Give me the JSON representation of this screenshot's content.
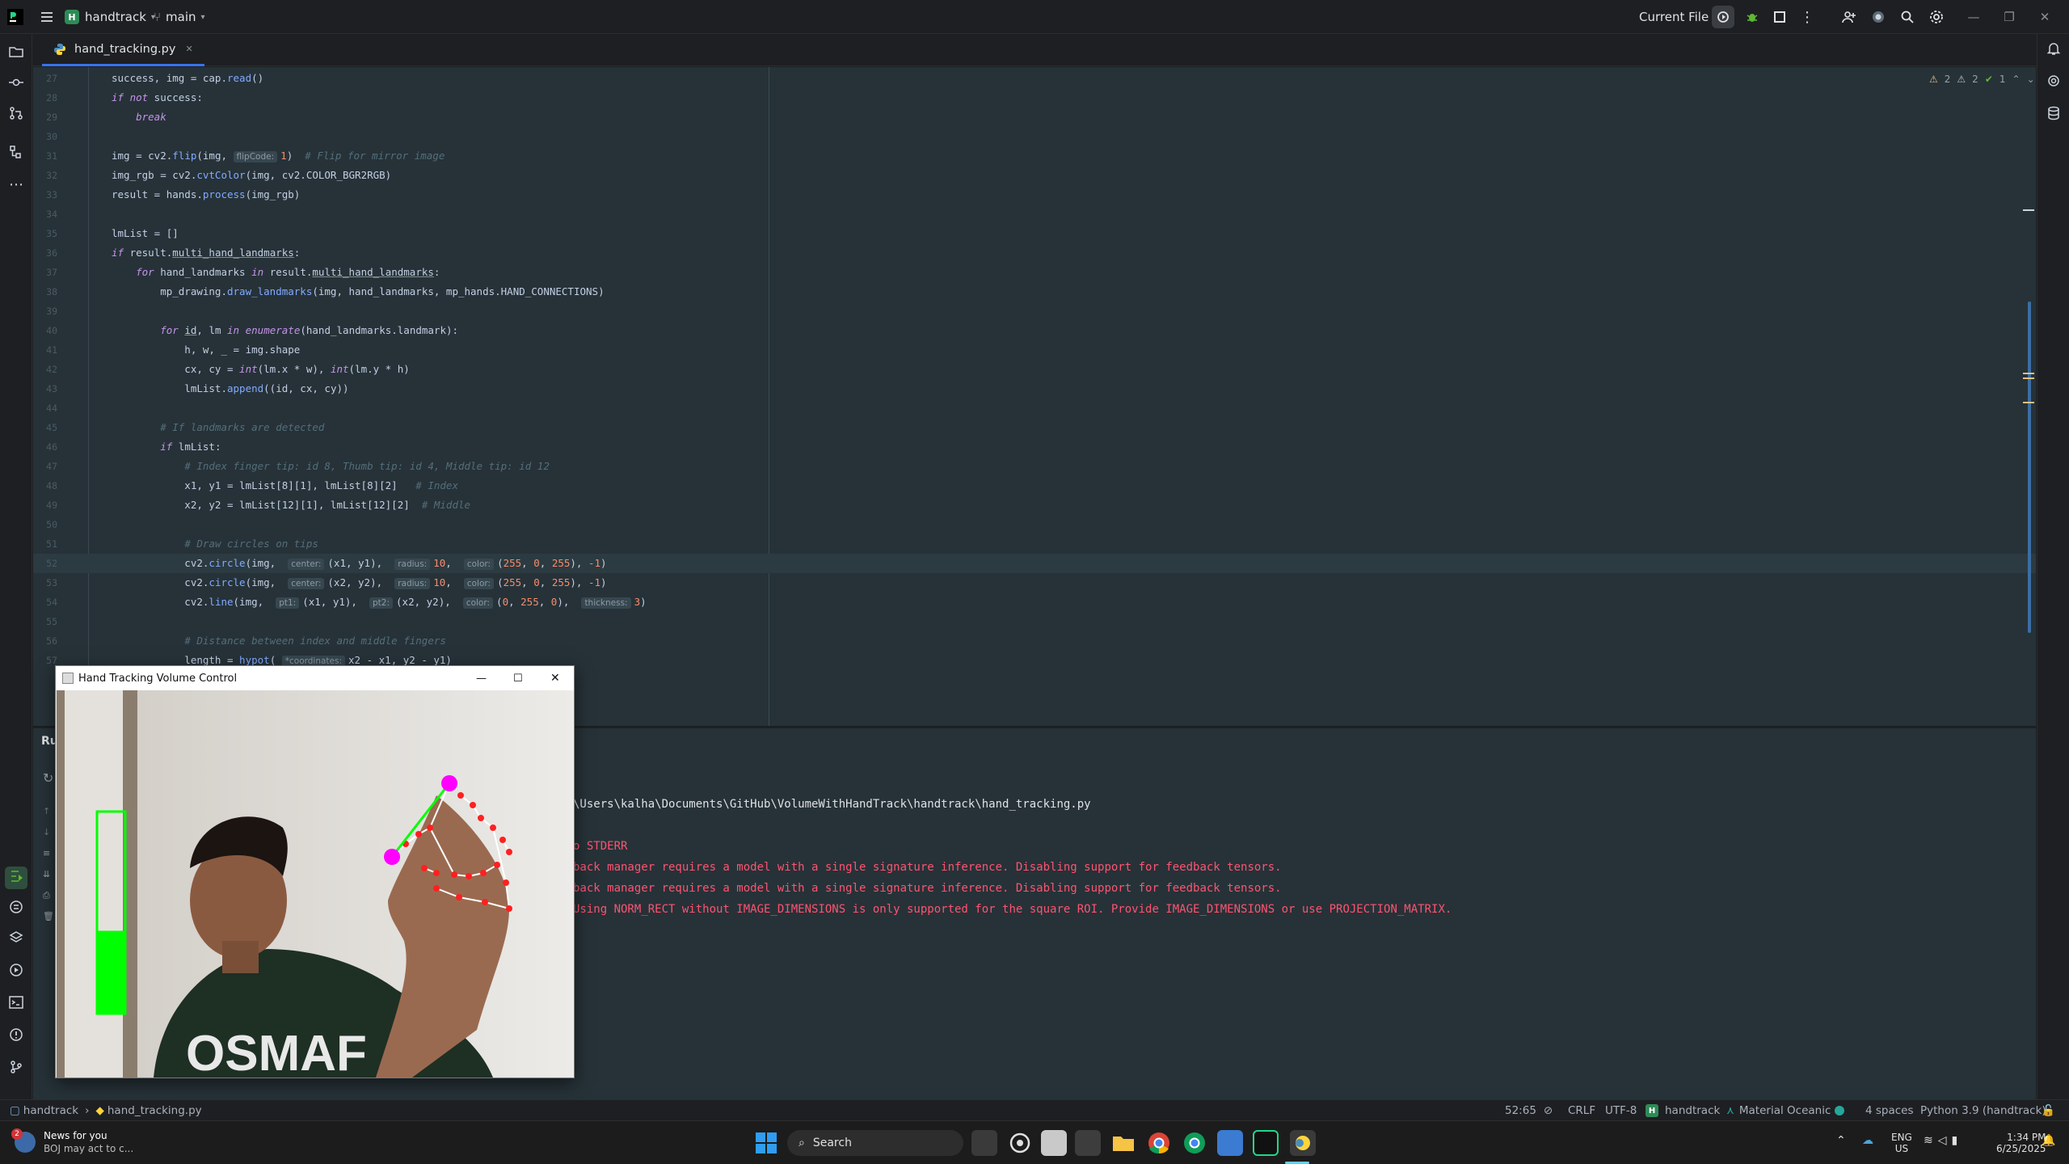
{
  "titlebar": {
    "project_badge": "H",
    "project_name": "handtrack",
    "branch": "main",
    "run_config": "Current File"
  },
  "editor_tab": {
    "filename": "hand_tracking.py"
  },
  "inspections": {
    "warnings_a": "2",
    "warnings_b": "2",
    "ok": "1"
  },
  "code_lines": [
    {
      "n": "27",
      "parts": [
        [
          "p",
          "success, img = cap."
        ],
        [
          "fn",
          "read"
        ],
        [
          "p",
          "()"
        ]
      ]
    },
    {
      "n": "28",
      "parts": [
        [
          "kw",
          "if not"
        ],
        [
          "p",
          " success:"
        ]
      ]
    },
    {
      "n": "29",
      "parts": [
        [
          "p",
          "    "
        ],
        [
          "kw",
          "break"
        ]
      ]
    },
    {
      "n": "30",
      "parts": []
    },
    {
      "n": "31",
      "parts": [
        [
          "p",
          "img = cv2."
        ],
        [
          "fn",
          "flip"
        ],
        [
          "p",
          "(img, "
        ],
        [
          "h",
          "flipCode:"
        ],
        [
          "num",
          "1"
        ],
        [
          "p",
          ")  "
        ],
        [
          "cm",
          "# Flip for mirror image"
        ]
      ]
    },
    {
      "n": "32",
      "parts": [
        [
          "p",
          "img_rgb = cv2."
        ],
        [
          "fn",
          "cvtColor"
        ],
        [
          "p",
          "(img, cv2.COLOR_BGR2RGB)"
        ]
      ]
    },
    {
      "n": "33",
      "parts": [
        [
          "p",
          "result = hands."
        ],
        [
          "fn",
          "process"
        ],
        [
          "p",
          "(img_rgb)"
        ]
      ]
    },
    {
      "n": "34",
      "parts": []
    },
    {
      "n": "35",
      "parts": [
        [
          "p",
          "lmList = []"
        ]
      ]
    },
    {
      "n": "36",
      "parts": [
        [
          "kw",
          "if"
        ],
        [
          "p",
          " result."
        ],
        [
          "ul",
          "multi_hand_landmarks"
        ],
        [
          "p",
          ":"
        ]
      ]
    },
    {
      "n": "37",
      "parts": [
        [
          "p",
          "    "
        ],
        [
          "kw",
          "for"
        ],
        [
          "p",
          " hand_landmarks "
        ],
        [
          "kw",
          "in"
        ],
        [
          "p",
          " result."
        ],
        [
          "ul",
          "multi_hand_landmarks"
        ],
        [
          "p",
          ":"
        ]
      ]
    },
    {
      "n": "38",
      "parts": [
        [
          "p",
          "        mp_drawing."
        ],
        [
          "fn",
          "draw_landmarks"
        ],
        [
          "p",
          "(img, hand_landmarks, mp_hands.HAND_CONNECTIONS)"
        ]
      ]
    },
    {
      "n": "39",
      "parts": []
    },
    {
      "n": "40",
      "parts": [
        [
          "p",
          "        "
        ],
        [
          "kw",
          "for"
        ],
        [
          "p",
          " "
        ],
        [
          "ul",
          "id"
        ],
        [
          "p",
          ", lm "
        ],
        [
          "kw",
          "in"
        ],
        [
          "p",
          " "
        ],
        [
          "kw",
          "enumerate"
        ],
        [
          "p",
          "(hand_landmarks.landmark):"
        ]
      ]
    },
    {
      "n": "41",
      "parts": [
        [
          "p",
          "            h, w, _ = img.shape"
        ]
      ]
    },
    {
      "n": "42",
      "parts": [
        [
          "p",
          "            cx, cy = "
        ],
        [
          "kw",
          "int"
        ],
        [
          "p",
          "(lm.x * w), "
        ],
        [
          "kw",
          "int"
        ],
        [
          "p",
          "(lm.y * h)"
        ]
      ]
    },
    {
      "n": "43",
      "parts": [
        [
          "p",
          "            lmList."
        ],
        [
          "fn",
          "append"
        ],
        [
          "p",
          "((id, cx, cy))"
        ]
      ]
    },
    {
      "n": "44",
      "parts": []
    },
    {
      "n": "45",
      "parts": [
        [
          "p",
          "        "
        ],
        [
          "cm",
          "# If landmarks are detected"
        ]
      ]
    },
    {
      "n": "46",
      "parts": [
        [
          "p",
          "        "
        ],
        [
          "kw",
          "if"
        ],
        [
          "p",
          " lmList:"
        ]
      ]
    },
    {
      "n": "47",
      "parts": [
        [
          "p",
          "            "
        ],
        [
          "cm",
          "# Index finger tip: id 8, Thumb tip: id 4, Middle tip: id 12"
        ]
      ]
    },
    {
      "n": "48",
      "parts": [
        [
          "p",
          "            x1, y1 = lmList[8][1], lmList[8][2]   "
        ],
        [
          "cm",
          "# Index"
        ]
      ]
    },
    {
      "n": "49",
      "parts": [
        [
          "p",
          "            x2, y2 = lmList[12][1], lmList[12][2]  "
        ],
        [
          "cm",
          "# Middle"
        ]
      ]
    },
    {
      "n": "50",
      "parts": []
    },
    {
      "n": "51",
      "parts": [
        [
          "p",
          "            "
        ],
        [
          "cm",
          "# Draw circles on tips"
        ]
      ]
    },
    {
      "n": "52",
      "parts": [
        [
          "p",
          "            cv2."
        ],
        [
          "fn",
          "circle"
        ],
        [
          "p",
          "(img,  "
        ],
        [
          "h",
          "center:"
        ],
        [
          "p",
          "(x1, y1),  "
        ],
        [
          "h",
          "radius:"
        ],
        [
          "num",
          "10"
        ],
        [
          "p",
          ",  "
        ],
        [
          "h",
          "color:"
        ],
        [
          "p",
          "("
        ],
        [
          "num",
          "255"
        ],
        [
          "p",
          ", "
        ],
        [
          "num",
          "0"
        ],
        [
          "p",
          ", "
        ],
        [
          "num",
          "255"
        ],
        [
          "p",
          "), "
        ],
        [
          "num",
          "-1"
        ],
        [
          "p",
          ")"
        ]
      ],
      "current": true
    },
    {
      "n": "53",
      "parts": [
        [
          "p",
          "            cv2."
        ],
        [
          "fn",
          "circle"
        ],
        [
          "p",
          "(img,  "
        ],
        [
          "h",
          "center:"
        ],
        [
          "p",
          "(x2, y2),  "
        ],
        [
          "h",
          "radius:"
        ],
        [
          "num",
          "10"
        ],
        [
          "p",
          ",  "
        ],
        [
          "h",
          "color:"
        ],
        [
          "p",
          "("
        ],
        [
          "num",
          "255"
        ],
        [
          "p",
          ", "
        ],
        [
          "num",
          "0"
        ],
        [
          "p",
          ", "
        ],
        [
          "num",
          "255"
        ],
        [
          "p",
          "), "
        ],
        [
          "num",
          "-1"
        ],
        [
          "p",
          ")"
        ]
      ]
    },
    {
      "n": "54",
      "parts": [
        [
          "p",
          "            cv2."
        ],
        [
          "fn",
          "line"
        ],
        [
          "p",
          "(img,  "
        ],
        [
          "h",
          "pt1:"
        ],
        [
          "p",
          "(x1, y1),  "
        ],
        [
          "h",
          "pt2:"
        ],
        [
          "p",
          "(x2, y2),  "
        ],
        [
          "h",
          "color:"
        ],
        [
          "p",
          "("
        ],
        [
          "num",
          "0"
        ],
        [
          "p",
          ", "
        ],
        [
          "num",
          "255"
        ],
        [
          "p",
          ", "
        ],
        [
          "num",
          "0"
        ],
        [
          "p",
          "),  "
        ],
        [
          "h",
          "thickness:"
        ],
        [
          "num",
          "3"
        ],
        [
          "p",
          ")"
        ]
      ]
    },
    {
      "n": "55",
      "parts": []
    },
    {
      "n": "56",
      "parts": [
        [
          "p",
          "            "
        ],
        [
          "cm",
          "# Distance between index and middle fingers"
        ]
      ]
    },
    {
      "n": "57",
      "parts": [
        [
          "p",
          "            length = "
        ],
        [
          "fn",
          "hypot"
        ],
        [
          "p",
          "( "
        ],
        [
          "h",
          "*coordinates:"
        ],
        [
          "p",
          "x2 - x1, y2 - y1)"
        ]
      ]
    }
  ],
  "run_panel": {
    "header": "Ru",
    "lines": [
      {
        "text": "\\Users\\kalha\\Documents\\GitHub\\VolumeWithHandTrack\\handtrack\\hand_tracking.py",
        "err": false
      },
      {
        "text": "",
        "err": false
      },
      {
        "text": "o STDERR",
        "err": true
      },
      {
        "text": "back manager requires a model with a single signature inference. Disabling support for feedback tensors.",
        "err": true
      },
      {
        "text": "back manager requires a model with a single signature inference. Disabling support for feedback tensors.",
        "err": true
      },
      {
        "text": "Using NORM_RECT without IMAGE_DIMENSIONS is only supported for the square ROI. Provide IMAGE_DIMENSIONS or use PROJECTION_MATRIX.",
        "err": true
      }
    ]
  },
  "popup_window": {
    "title": "Hand Tracking Volume Control",
    "shirt_text": "OSMAF",
    "volume_level": 0.41
  },
  "statusbar": {
    "project": "handtrack",
    "file": "hand_tracking.py",
    "position": "52:65",
    "line_sep": "CRLF",
    "encoding": "UTF-8",
    "venv_badge": "H",
    "venv": "handtrack",
    "theme": "Material Oceanic",
    "indent": "4 spaces",
    "interpreter": "Python 3.9 (handtrack)"
  },
  "taskbar": {
    "news_title": "News for you",
    "news_sub": "BOJ may act to c...",
    "news_badge": "2",
    "search": "Search",
    "lang1": "ENG",
    "lang2": "US",
    "time": "1:34 PM",
    "date": "6/25/2025"
  },
  "colors": {
    "accent": "#3574f0",
    "editor_bg": "#263238",
    "error": "#ff5370",
    "landmark": "#ff00ff",
    "volume_bar": "#00ff00"
  }
}
